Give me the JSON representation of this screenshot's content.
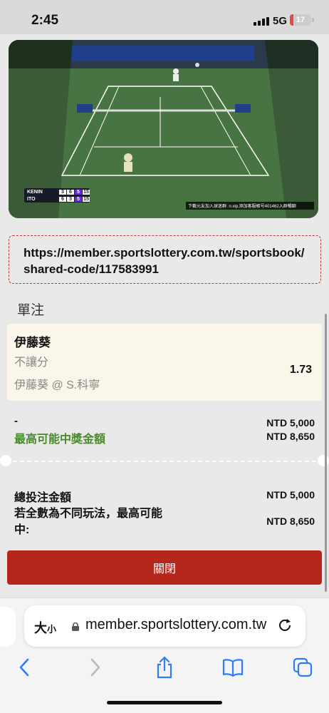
{
  "status_bar": {
    "time": "2:45",
    "network": "5G",
    "battery": "17",
    "battery_level": 0.17
  },
  "video": {
    "scoreboard": [
      {
        "player": "KENIN",
        "scores": [
          "3",
          "6",
          "5",
          "15"
        ]
      },
      {
        "player": "ITO",
        "scores": [
          "6",
          "3",
          "5",
          "15"
        ]
      }
    ],
    "caption": "下載元友加入球迷群: n.vip,添加客服帳号401462入群暢聊"
  },
  "share": {
    "url": "https://member.sportslottery.com.tw/sportsbook/shared-code/117583991"
  },
  "bet": {
    "section_title": "單注",
    "player": "伊藤葵",
    "market": "不讓分",
    "selection": "伊藤葵 @ S.科寧",
    "odds": "1.73"
  },
  "summary": {
    "dash": "-",
    "stake": "NTD 5,000",
    "max_win_label": "最高可能中獎金額",
    "max_win_amount": "NTD 8,650",
    "total_label": "總投注金額",
    "total_amount": "NTD 5,000",
    "maybe_label": "若全數為不同玩法，最高可能中:",
    "maybe_amount": "NTD 8,650"
  },
  "actions": {
    "close_label": "關閉"
  },
  "browser": {
    "reader_label": "大",
    "reader_small": "小",
    "url": "member.sportslottery.com.tw"
  },
  "colors": {
    "accent_red": "#b5261d",
    "win_green": "#4a8a2c",
    "dashed_border": "#c0353a"
  }
}
